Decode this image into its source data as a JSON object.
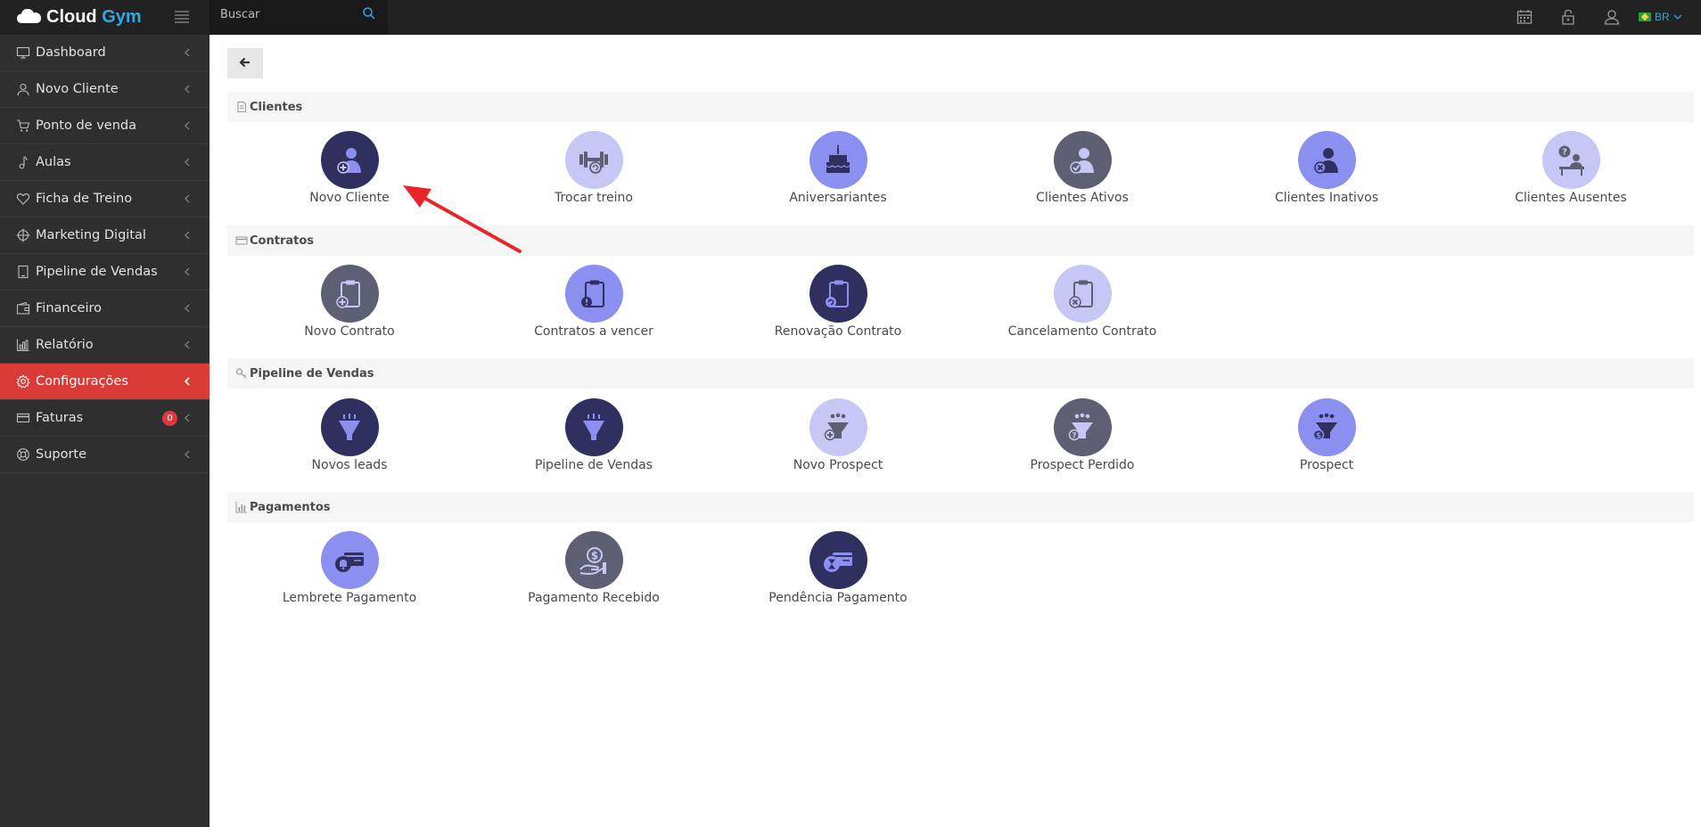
{
  "brand": {
    "name_part1": "Cloud",
    "name_part2": "Gym"
  },
  "search": {
    "placeholder": "Buscar"
  },
  "topbar": {
    "language": "BR"
  },
  "sidebar": {
    "items": [
      {
        "label": "Dashboard"
      },
      {
        "label": "Novo Cliente"
      },
      {
        "label": "Ponto de venda"
      },
      {
        "label": "Aulas"
      },
      {
        "label": "Ficha de Treino"
      },
      {
        "label": "Marketing Digital"
      },
      {
        "label": "Pipeline de Vendas"
      },
      {
        "label": "Financeiro"
      },
      {
        "label": "Relatório"
      },
      {
        "label": "Configurações"
      },
      {
        "label": "Faturas",
        "badge": "0"
      },
      {
        "label": "Suporte"
      }
    ]
  },
  "sections": [
    {
      "title": "Clientes",
      "tiles": [
        {
          "label": "Novo Cliente"
        },
        {
          "label": "Trocar treino"
        },
        {
          "label": "Aniversariantes"
        },
        {
          "label": "Clientes Ativos"
        },
        {
          "label": "Clientes Inativos"
        },
        {
          "label": "Clientes Ausentes"
        }
      ]
    },
    {
      "title": "Contratos",
      "tiles": [
        {
          "label": "Novo Contrato"
        },
        {
          "label": "Contratos a vencer"
        },
        {
          "label": "Renovação Contrato"
        },
        {
          "label": "Cancelamento Contrato"
        }
      ]
    },
    {
      "title": "Pipeline de Vendas",
      "tiles": [
        {
          "label": "Novos leads"
        },
        {
          "label": "Pipeline de Vendas"
        },
        {
          "label": "Novo Prospect"
        },
        {
          "label": "Prospect Perdido"
        },
        {
          "label": "Prospect"
        }
      ]
    },
    {
      "title": "Pagamentos",
      "tiles": [
        {
          "label": "Lembrete Pagamento"
        },
        {
          "label": "Pagamento Recebido"
        },
        {
          "label": "Pendência Pagamento"
        }
      ]
    }
  ],
  "colors": {
    "topbar": "#222222",
    "sidebar": "#2f2f2f",
    "sidebar_active": "#da3b36",
    "brand_accent": "#35a6e0",
    "annotation_arrow": "#e8262a"
  }
}
